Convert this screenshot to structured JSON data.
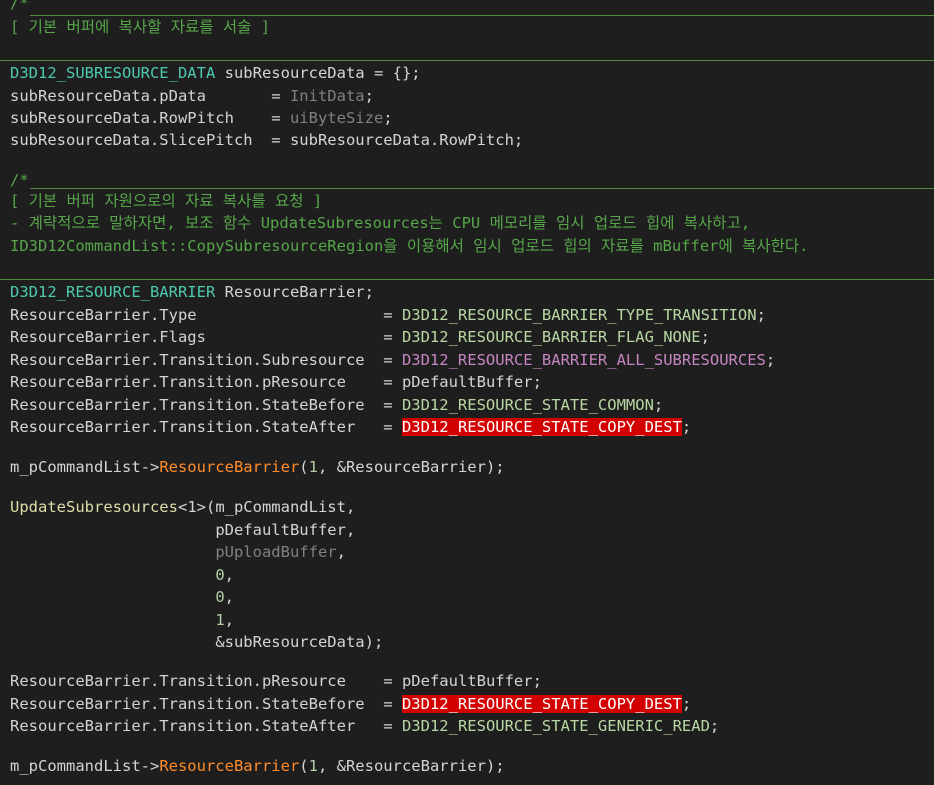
{
  "comments": {
    "c1_open": "/*",
    "c1_text": "[ 기본 버퍼에 복사할 자료를 서술 ]",
    "c2_open": "/*",
    "c2_text": "[ 기본 버퍼 자원으로의 자료 복사를 요청 ]",
    "c2_line2": "- 계략적으로 말하자면, 보조 함수 UpdateSubresources는 CPU 메모리를 임시 업로드 힙에 복사하고,",
    "c2_line3": "ID3D12CommandList::CopySubresourceRegion을 이용해서 임시 업로드 힙의 자료를 mBuffer에 복사한다."
  },
  "code": {
    "l1_type": "D3D12_SUBRESOURCE_DATA",
    "l1_rest": " subResourceData = {};",
    "l2_left": "subResourceData.pData",
    "l2_pad": "       = ",
    "l2_val": "InitData",
    "l2_end": ";",
    "l3_left": "subResourceData.RowPitch",
    "l3_pad": "    = ",
    "l3_val": "uiByteSize",
    "l3_end": ";",
    "l4_left": "subResourceData.SlicePitch",
    "l4_pad": "  = ",
    "l4_val": "subResourceData.RowPitch;",
    "b1_type": "D3D12_RESOURCE_BARRIER",
    "b1_rest": " ResourceBarrier;",
    "b2_left": "ResourceBarrier.Type",
    "b2_pad": "                    = ",
    "b2_val": "D3D12_RESOURCE_BARRIER_TYPE_TRANSITION",
    "b3_left": "ResourceBarrier.Flags",
    "b3_pad": "                   = ",
    "b3_val": "D3D12_RESOURCE_BARRIER_FLAG_NONE",
    "b4_left": "ResourceBarrier.Transition.Subresource",
    "b4_pad": "  = ",
    "b4_val": "D3D12_RESOURCE_BARRIER_ALL_SUBRESOURCES",
    "b5_left": "ResourceBarrier.Transition.pResource",
    "b5_pad": "    = ",
    "b5_val": "pDefaultBuffer;",
    "b6_left": "ResourceBarrier.Transition.StateBefore",
    "b6_pad": "  = ",
    "b6_val": "D3D12_RESOURCE_STATE_COMMON",
    "b7_left": "ResourceBarrier.Transition.StateAfter",
    "b7_pad": "   = ",
    "b7_val": "D3D12_RESOURCE_STATE_COPY_DEST",
    "semi": ";",
    "call1_obj": "m_pCommandList->",
    "call1_fn": "ResourceBarrier",
    "call1_open": "(",
    "call1_num": "1",
    "call1_rest": ", &ResourceBarrier);",
    "u_fn": "UpdateSubresources",
    "u_tpl": "<1>",
    "u_args0": "(m_pCommandList,",
    "u_indent": "                      ",
    "u_arg1": "pDefaultBuffer,",
    "u_arg2": "pUploadBuffer",
    "u_arg2_end": ",",
    "u_arg3": "0",
    "u_arg4": "0",
    "u_arg5": "1",
    "u_comma": ",",
    "u_arg6": "&subResourceData);",
    "r1_left": "ResourceBarrier.Transition.pResource",
    "r1_pad": "    = ",
    "r1_val": "pDefaultBuffer;",
    "r2_left": "ResourceBarrier.Transition.StateBefore",
    "r2_pad": "  = ",
    "r2_val": "D3D12_RESOURCE_STATE_COPY_DEST",
    "r3_left": "ResourceBarrier.Transition.StateAfter",
    "r3_pad": "   = ",
    "r3_val": "D3D12_RESOURCE_STATE_GENERIC_READ",
    "call2_obj": "m_pCommandList->",
    "call2_fn": "ResourceBarrier",
    "call2_open": "(",
    "call2_num": "1",
    "call2_rest": ", &ResourceBarrier);"
  }
}
